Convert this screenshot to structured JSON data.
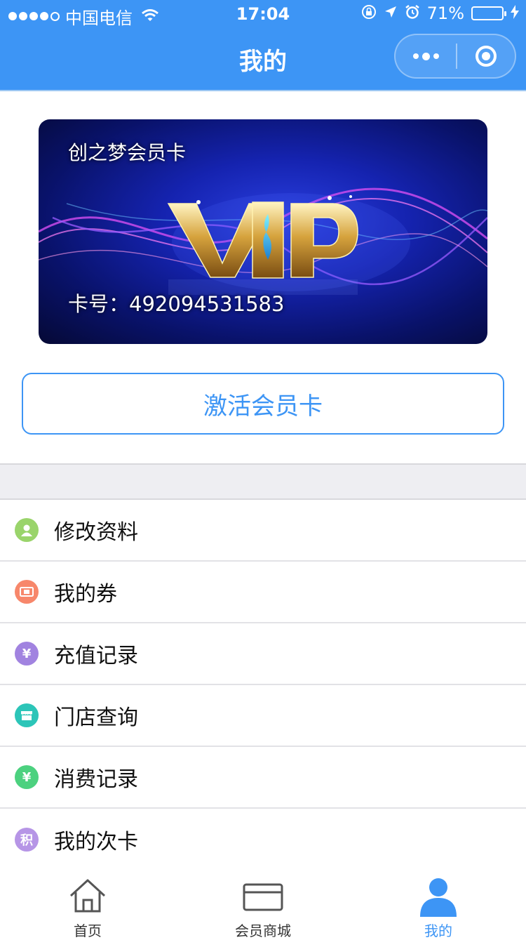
{
  "status_bar": {
    "carrier": "中国电信",
    "time": "17:04",
    "battery_percent": "71%",
    "battery_level": 0.71
  },
  "header": {
    "title": "我的"
  },
  "card": {
    "name": "创之梦会员卡",
    "vip_text": "VIP",
    "number_label": "卡号：",
    "number": "492094531583"
  },
  "activate_button": {
    "label": "激活会员卡"
  },
  "menu": [
    {
      "label": "修改资料",
      "icon": "user-icon",
      "color": "#9ad46b",
      "glyph": ""
    },
    {
      "label": "我的券",
      "icon": "coupon-icon",
      "color": "#f7876b",
      "glyph": ""
    },
    {
      "label": "充值记录",
      "icon": "recharge-icon",
      "color": "#a183e0",
      "glyph": "¥"
    },
    {
      "label": "门店查询",
      "icon": "store-icon",
      "color": "#2cc5b8",
      "glyph": ""
    },
    {
      "label": "消费记录",
      "icon": "consume-icon",
      "color": "#4cd17f",
      "glyph": "¥"
    },
    {
      "label": "我的次卡",
      "icon": "points-card-icon",
      "color": "#b695e6",
      "glyph": "积"
    }
  ],
  "tabbar": {
    "tabs": [
      {
        "label": "首页",
        "icon": "home-icon"
      },
      {
        "label": "会员商城",
        "icon": "card-icon"
      },
      {
        "label": "我的",
        "icon": "profile-icon",
        "active": true
      }
    ]
  },
  "colors": {
    "accent": "#3d95f5",
    "page_background": "#ffffff",
    "divider_background": "#eeeef2"
  }
}
